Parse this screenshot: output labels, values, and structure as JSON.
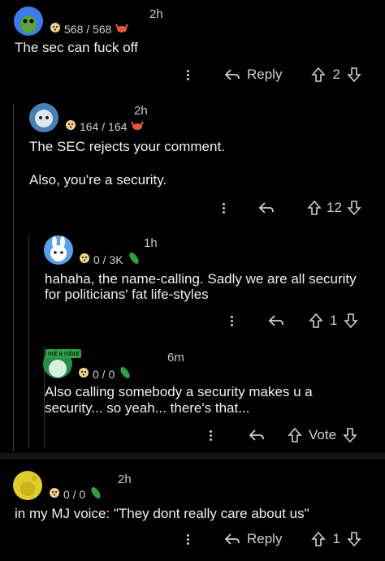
{
  "comments": [
    {
      "meta": "568 / 568",
      "time": "2h",
      "text": "The sec can fuck off",
      "reply_label": "Reply",
      "votes": "2"
    },
    {
      "meta": "164 / 164",
      "time": "2h",
      "text_lines": [
        "The SEC rejects your comment.",
        "",
        "Also, you're a security."
      ],
      "votes": "12"
    },
    {
      "meta": "0 / 3K",
      "time": "1h",
      "text_lines": [
        "hahaha, the name-calling. Sadly we are all security",
        "for politicians' fat life-styles"
      ],
      "votes": "1"
    },
    {
      "meta": "0 / 0",
      "time": "6m",
      "badge": "not a robot",
      "text_lines": [
        "Also calling somebody a security makes u a",
        "security... so yeah... there's that..."
      ],
      "vote_label": "Vote"
    },
    {
      "meta": "0 / 0",
      "time": "2h",
      "text": "in my MJ voice: \"They dont really care about us\"",
      "reply_label": "Reply",
      "votes": "1"
    }
  ],
  "colors": {
    "background": "#000000",
    "thread_line": "#3a3a3a",
    "accent_green": "#2f9e44",
    "accent_red": "#e8573a"
  },
  "icons": [
    "more-icon",
    "reply-icon",
    "upvote-icon",
    "downvote-icon",
    "karma-icon",
    "crab-icon",
    "pickle-icon"
  ]
}
